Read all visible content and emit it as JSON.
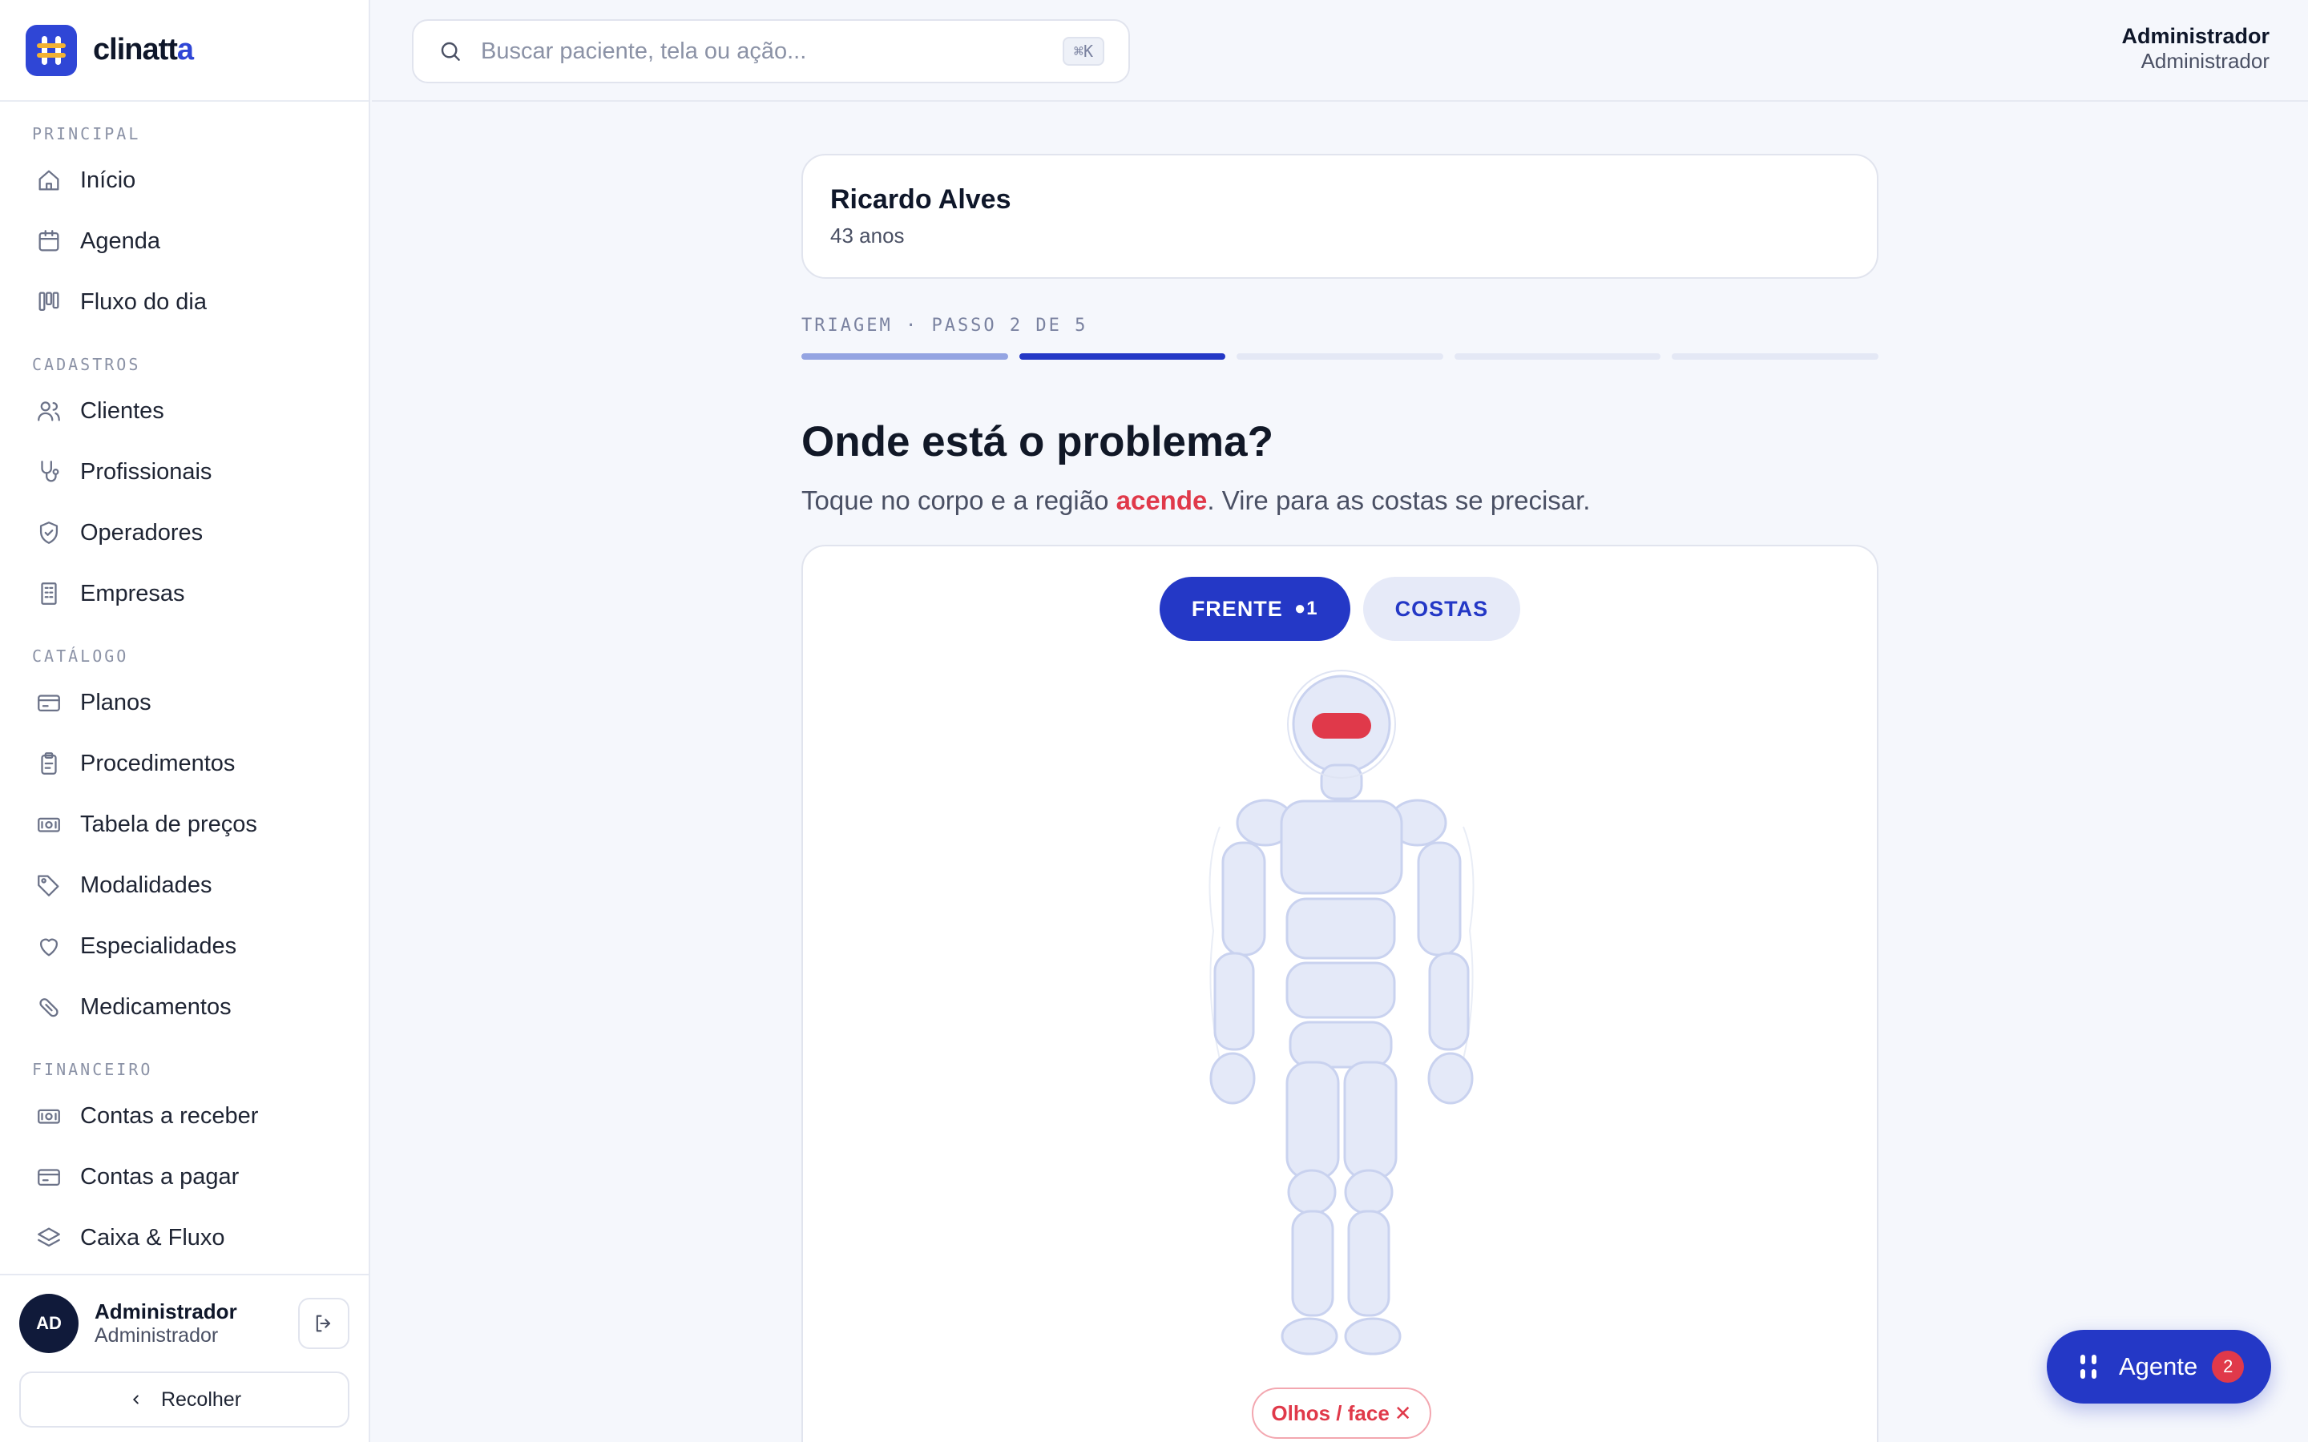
{
  "brand": {
    "name_main": "clinatt",
    "name_accent": "a"
  },
  "search": {
    "placeholder": "Buscar paciente, tela ou ação...",
    "shortcut": "⌘K"
  },
  "header_user": {
    "name": "Administrador",
    "role": "Administrador"
  },
  "sidebar": {
    "sections": [
      {
        "title": "PRINCIPAL",
        "items": [
          {
            "label": "Início",
            "icon": "home-icon"
          },
          {
            "label": "Agenda",
            "icon": "calendar-icon"
          },
          {
            "label": "Fluxo do dia",
            "icon": "kanban-icon"
          }
        ]
      },
      {
        "title": "CADASTROS",
        "items": [
          {
            "label": "Clientes",
            "icon": "users-icon"
          },
          {
            "label": "Profissionais",
            "icon": "stethoscope-icon"
          },
          {
            "label": "Operadores",
            "icon": "shield-icon"
          },
          {
            "label": "Empresas",
            "icon": "building-icon"
          }
        ]
      },
      {
        "title": "CATÁLOGO",
        "items": [
          {
            "label": "Planos",
            "icon": "card-icon"
          },
          {
            "label": "Procedimentos",
            "icon": "clipboard-icon"
          },
          {
            "label": "Tabela de preços",
            "icon": "banknote-icon"
          },
          {
            "label": "Modalidades",
            "icon": "tag-icon"
          },
          {
            "label": "Especialidades",
            "icon": "heart-icon"
          },
          {
            "label": "Medicamentos",
            "icon": "pill-icon"
          }
        ]
      },
      {
        "title": "FINANCEIRO",
        "items": [
          {
            "label": "Contas a receber",
            "icon": "banknote-icon"
          },
          {
            "label": "Contas a pagar",
            "icon": "card-icon"
          },
          {
            "label": "Caixa & Fluxo",
            "icon": "layers-icon"
          }
        ]
      }
    ],
    "footer": {
      "avatar": "AD",
      "name": "Administrador",
      "role": "Administrador",
      "collapse_label": "Recolher"
    }
  },
  "patient": {
    "name": "Ricardo Alves",
    "age": "43 anos"
  },
  "triage": {
    "step_label": "TRIAGEM · PASSO 2 DE 5",
    "current_step": 2,
    "total_steps": 5
  },
  "question": {
    "title": "Onde está o problema?",
    "subtitle_before": "Toque no corpo e a região ",
    "subtitle_highlight": "acende",
    "subtitle_after": ". Vire para as costas se precisar."
  },
  "view_toggle": {
    "front_label": "FRENTE",
    "front_count": "●1",
    "back_label": "COSTAS"
  },
  "selected_regions": [
    {
      "label": "Olhos / face",
      "remove": "✕"
    }
  ],
  "colors": {
    "primary": "#2438c6",
    "selected": "#e0394a",
    "region_fill": "#e4e9f8",
    "region_stroke": "#c9d2ef"
  },
  "agent": {
    "label": "Agente",
    "badge": "2"
  }
}
